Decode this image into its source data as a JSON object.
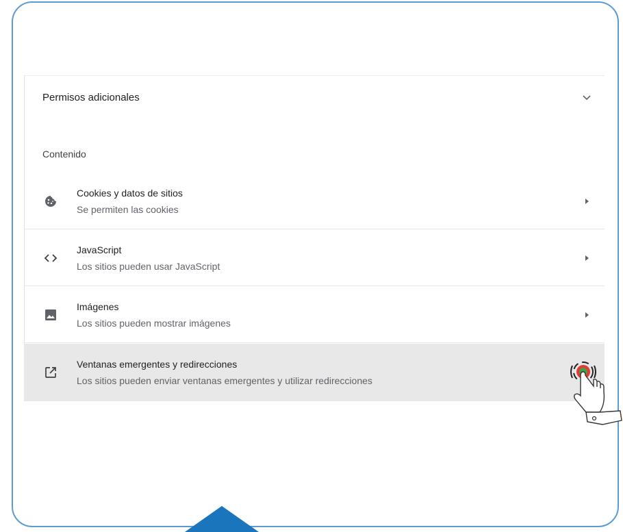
{
  "section": {
    "title": "Permisos adicionales",
    "chevron_icon": "chevron-down-icon"
  },
  "content": {
    "title": "Contenido",
    "items": [
      {
        "title": "Cookies y datos de sitios",
        "subtitle": "Se permiten las cookies",
        "icon": "cookie-icon"
      },
      {
        "title": "JavaScript",
        "subtitle": "Los sitios pueden usar JavaScript",
        "icon": "code-icon"
      },
      {
        "title": "Imágenes",
        "subtitle": "Los sitios pueden mostrar imágenes",
        "icon": "image-icon"
      },
      {
        "title": "Ventanas emergentes y redirecciones",
        "subtitle": "Los sitios pueden enviar ventanas emergentes y utilizar redirecciones",
        "icon": "open-in-new-icon"
      }
    ]
  },
  "colors": {
    "frame_border": "#5b9bd5",
    "highlight_row": "#e8e8e8",
    "accent_triangle": "#1b75bc",
    "primary_text": "#202124",
    "secondary_text": "#5f6368"
  }
}
